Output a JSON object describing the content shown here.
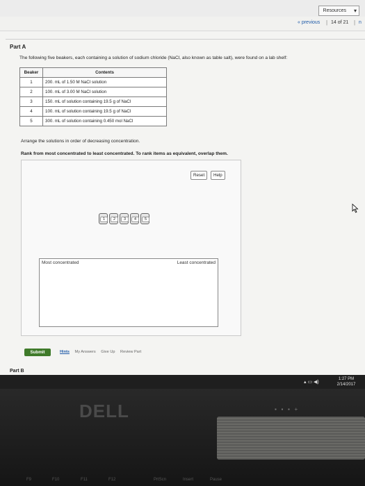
{
  "header": {
    "resources_label": "Resources",
    "resources_chevron": "▾"
  },
  "nav": {
    "previous": "« previous",
    "sep": "|",
    "count": "14 of 21",
    "next": "n"
  },
  "part_a": {
    "title": "Part A",
    "intro": "The following five beakers, each containing a solution of sodium chloride (NaCl, also known as table salt), were found on a lab shelf:",
    "table": {
      "headers": [
        "Beaker",
        "Contents"
      ],
      "rows": [
        [
          "1",
          "200. mL of 1.50 M NaCl solution"
        ],
        [
          "2",
          "100. mL of 3.00 M NaCl solution"
        ],
        [
          "3",
          "150. mL of solution containing 19.5 g of NaCl"
        ],
        [
          "4",
          "100. mL of solution containing 19.5 g of NaCl"
        ],
        [
          "5",
          "300. mL of solution containing 0.450 mol NaCl"
        ]
      ]
    },
    "instruction": "Arrange the solutions in order of decreasing concentration.",
    "rank_instruction": "Rank from most concentrated to least concentrated. To rank items as equivalent, overlap them.",
    "reset_label": "Reset",
    "help_label": "Help",
    "items": [
      "1",
      "2",
      "3",
      "4",
      "5"
    ],
    "most_label": "Most concentrated",
    "least_label": "Least concentrated",
    "submit_label": "Submit",
    "hints_label": "Hints",
    "my_answers_label": "My Answers",
    "give_up_label": "Give Up",
    "review_part_label": "Review Part"
  },
  "part_b": {
    "title": "Part B"
  },
  "taskbar": {
    "time": "1:27 PM",
    "date": "2/14/2017"
  },
  "monitor": {
    "brand": "DELL",
    "keys": [
      "F9",
      "F10",
      "F11",
      "F12",
      "PrtScn",
      "Insert",
      "Pause"
    ]
  },
  "icons": [
    "chevron-down-icon",
    "volume-icon",
    "battery-icon",
    "mouse-cursor-icon"
  ]
}
